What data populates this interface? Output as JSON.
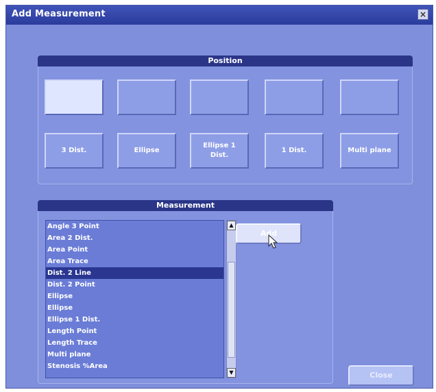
{
  "dialog": {
    "title": "Add Measurement",
    "close_glyph": "×"
  },
  "position": {
    "header": "Position",
    "top_buttons": [
      {
        "label": ""
      },
      {
        "label": ""
      },
      {
        "label": ""
      },
      {
        "label": ""
      },
      {
        "label": ""
      }
    ],
    "bottom_buttons": [
      {
        "label": "3 Dist."
      },
      {
        "label": "Ellipse"
      },
      {
        "label": "Ellipse 1\nDist."
      },
      {
        "label": "1 Dist."
      },
      {
        "label": "Multi plane"
      }
    ]
  },
  "measurement": {
    "header": "Measurement",
    "items": [
      "Angle 3 Point",
      "Area 2 Dist.",
      "Area Point",
      "Area Trace",
      "Dist. 2 Line",
      "Dist. 2 Point",
      "Ellipse",
      "Ellipse",
      "Ellipse 1 Dist.",
      "Length Point",
      "Length Trace",
      "Multi plane",
      "Stenosis %Area"
    ],
    "selected_index": 4,
    "scroll_up_glyph": "▲",
    "scroll_down_glyph": "▼"
  },
  "buttons": {
    "add": "Add",
    "close": "Close"
  }
}
